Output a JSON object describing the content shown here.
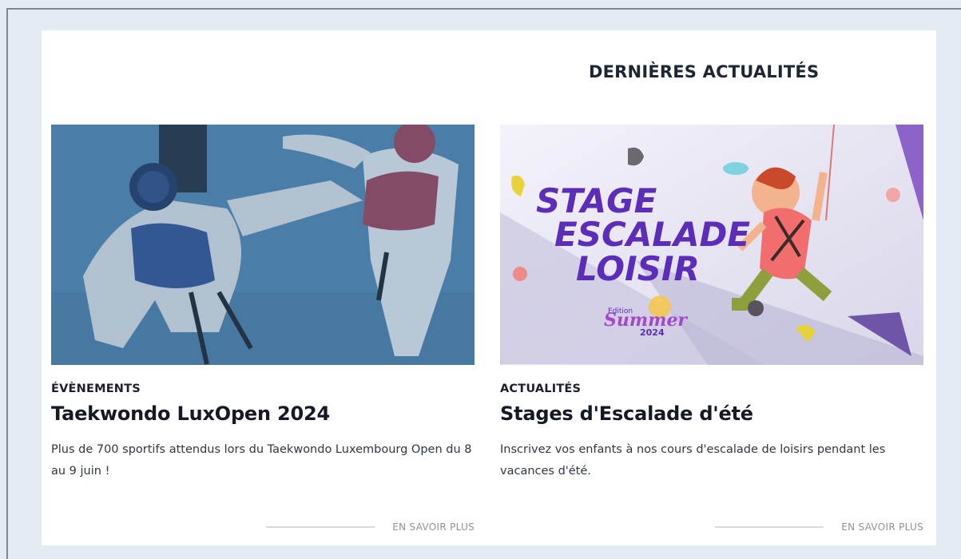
{
  "section": {
    "title": "DERNIÈRES ACTUALITÉS"
  },
  "cards": [
    {
      "category": "ÉVÈNEMENTS",
      "title": "Taekwondo LuxOpen 2024",
      "excerpt": "Plus de 700 sportifs attendus lors du Taekwondo Luxembourg Open du 8 au 9 juin !",
      "link_label": "EN SAVOIR PLUS",
      "image_icon": "taekwondo-photo"
    },
    {
      "category": "ACTUALITÉS",
      "title": "Stages d'Escalade d'été",
      "excerpt": "Inscrivez vos enfants à nos cours d'escalade de loisirs pendant les vacances d'été.",
      "link_label": "EN SAVOIR PLUS",
      "image_icon": "climbing-poster",
      "poster": {
        "line1": "STAGE",
        "line2": "ESCALADE",
        "line3": "LOISIR",
        "edition": "Edition",
        "season": "Summer",
        "year": "2024"
      }
    }
  ],
  "colors": {
    "page_bg": "#e4ebf3",
    "panel_bg": "#ffffff",
    "text_dark": "#141a24",
    "link_muted": "#8b939e",
    "photo_tint": "#4b7fa8",
    "poster_purple": "#5b2db8"
  }
}
